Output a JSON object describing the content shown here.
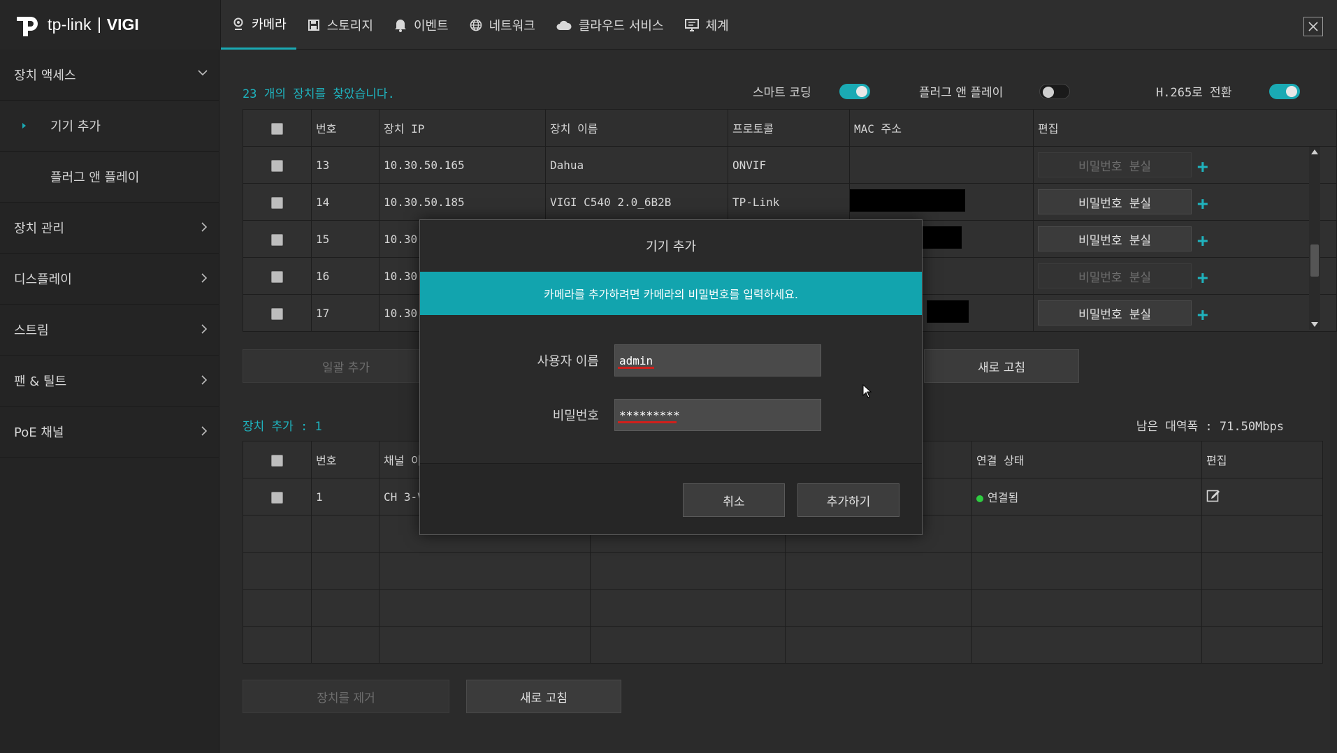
{
  "app": {
    "brand": "tp-link",
    "product": "VIGI"
  },
  "tabs": [
    {
      "label": "카메라",
      "icon": "camera-icon",
      "active": true
    },
    {
      "label": "스토리지",
      "icon": "storage-icon"
    },
    {
      "label": "이벤트",
      "icon": "bell-icon"
    },
    {
      "label": "네트워크",
      "icon": "globe-icon"
    },
    {
      "label": "클라우드 서비스",
      "icon": "cloud-icon"
    },
    {
      "label": "체계",
      "icon": "monitor-icon"
    }
  ],
  "sidebar": {
    "items": [
      {
        "label": "장치 액세스",
        "expanded": true
      },
      {
        "label": "기기 추가",
        "active": true
      },
      {
        "label": "플러그 앤 플레이"
      },
      {
        "label": "장치 관리"
      },
      {
        "label": "디스플레이"
      },
      {
        "label": "스트림"
      },
      {
        "label": "팬 & 틸트"
      },
      {
        "label": "PoE 채널"
      }
    ]
  },
  "search": {
    "found_text": "23 개의 장치를 찾았습니다.",
    "smart_coding_label": "스마트 코딩",
    "smart_coding_on": true,
    "plug_play_label": "플러그 앤 플레이",
    "plug_play_on": false,
    "h265_label": "H.265로 전환",
    "h265_on": true
  },
  "found_table": {
    "headers": [
      "번호",
      "장치 IP",
      "장치 이름",
      "프로토콜",
      "MAC 주소",
      "편집"
    ],
    "rows": [
      {
        "no": "13",
        "ip": "10.30.50.165",
        "name": "Dahua",
        "protocol": "ONVIF",
        "action": "비밀번호 분실",
        "action_enabled": false
      },
      {
        "no": "14",
        "ip": "10.30.50.185",
        "name": "VIGI C540 2.0_6B2B",
        "protocol": "TP-Link",
        "action": "비밀번호 분실",
        "action_enabled": true
      },
      {
        "no": "15",
        "ip": "10.30.",
        "name": "",
        "protocol": "",
        "action": "비밀번호 분실",
        "action_enabled": true
      },
      {
        "no": "16",
        "ip": "10.30.",
        "name": "",
        "protocol": "",
        "action": "비밀번호 분실",
        "action_enabled": false
      },
      {
        "no": "17",
        "ip": "10.30.",
        "name": "",
        "protocol": "",
        "action": "비밀번호 분실",
        "action_enabled": true
      }
    ],
    "batch_add": "일괄 추가",
    "refresh": "새로 고침"
  },
  "added": {
    "count_text": "장치 추가 : 1",
    "bandwidth_text": "남은 대역폭 : 71.50Mbps",
    "headers": [
      "번호",
      "채널 이",
      "연결 상태",
      "편집"
    ],
    "rows": [
      {
        "no": "1",
        "channel": "CH 3-V",
        "status": "연결됨"
      }
    ],
    "remove": "장치를 제거",
    "refresh": "새로 고침"
  },
  "modal": {
    "title": "기기 추가",
    "banner": "카메라를 추가하려면 카메라의 비밀번호를 입력하세요.",
    "username_label": "사용자 이름",
    "username_value": "admin",
    "password_label": "비밀번호",
    "password_value": "*********",
    "cancel": "취소",
    "confirm": "추가하기"
  },
  "colors": {
    "accent": "#1aaab4",
    "status_ok": "#2ecc40"
  }
}
